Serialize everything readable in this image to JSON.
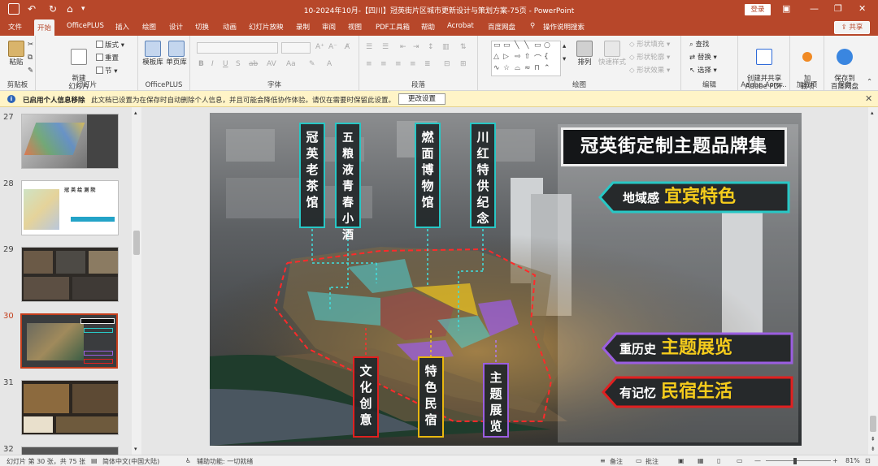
{
  "titlebar": {
    "title": "10-2024年10月-【四川】冠英街片区城市更新设计与策划方案-75页  -  PowerPoint",
    "login": "登录"
  },
  "tabs": [
    "文件",
    "开始",
    "OfficePLUS",
    "插入",
    "绘图",
    "设计",
    "切换",
    "动画",
    "幻灯片放映",
    "录制",
    "审阅",
    "视图",
    "PDF工具箱",
    "帮助",
    "Acrobat",
    "百度网盘",
    "操作说明搜索"
  ],
  "share_label": "共享",
  "ribbon": {
    "clipboard": {
      "paste": "粘贴",
      "label": "剪贴板"
    },
    "slides": {
      "new_slide": "新建\n幻灯片",
      "layout": "版式",
      "reset": "重置",
      "section": "节",
      "label": "幻灯片"
    },
    "officeplus": {
      "template": "模板库",
      "single": "单页库",
      "label": "OfficePLUS"
    },
    "font": {
      "label": "字体"
    },
    "paragraph": {
      "label": "段落"
    },
    "drawing": {
      "arrange": "排列",
      "quickstyle": "快速样式",
      "fill": "形状填充",
      "outline": "形状轮廓",
      "effect": "形状效果",
      "label": "绘图"
    },
    "editing": {
      "find": "查找",
      "replace": "替换",
      "select": "选择",
      "label": "编辑"
    },
    "adobe": {
      "create": "创建并共享\nAdobe PDF",
      "label": "Adobe Acro..."
    },
    "addins": {
      "addin": "加\n载项",
      "label": "加载项"
    },
    "save": {
      "save_to": "保存到\n百度网盘",
      "label": "保存"
    }
  },
  "infobar": {
    "title": "已启用个人信息移除",
    "message": "此文档已设置为在保存时自动删除个人信息，并且可能会降低协作体验。请仅在需要时保留此设置。",
    "button": "更改设置"
  },
  "thumbnails": [
    {
      "num": "27",
      "current": false
    },
    {
      "num": "28",
      "current": false,
      "text": "冠 英 绘 测 院"
    },
    {
      "num": "29",
      "current": false
    },
    {
      "num": "30",
      "current": true
    },
    {
      "num": "31",
      "current": false
    },
    {
      "num": "32",
      "current": false
    }
  ],
  "slide": {
    "banners_top": [
      "冠\n英\n老\n茶\n馆",
      "五\n粮\n液\n青\n春\n小\n酒",
      "燃\n面\n博\n物\n馆",
      "川\n红\n特\n供\n纪\n念"
    ],
    "banners_bottom": [
      "文\n化\n创\n意",
      "特\n色\n民\n宿",
      "主\n题\n展\n览"
    ],
    "title": "冠英街定制主题品牌集",
    "tags": [
      {
        "small": "地域感",
        "big": "宜宾特色"
      },
      {
        "small": "重历史",
        "big": "主题展览"
      },
      {
        "small": "有记忆",
        "big": "民宿生活"
      }
    ]
  },
  "statusbar": {
    "slide_info": "幻灯片 第 30 张，共 75 张",
    "language": "简体中文(中国大陆)",
    "accessibility": "辅助功能: 一切就绪",
    "notes": "备注",
    "comments": "批注",
    "zoom": "81%"
  },
  "colors": {
    "accent": "#b7472a",
    "teal": "#28c7c5",
    "red": "#e02020",
    "yellow": "#e8b70f",
    "purple": "#9b5ee0"
  }
}
